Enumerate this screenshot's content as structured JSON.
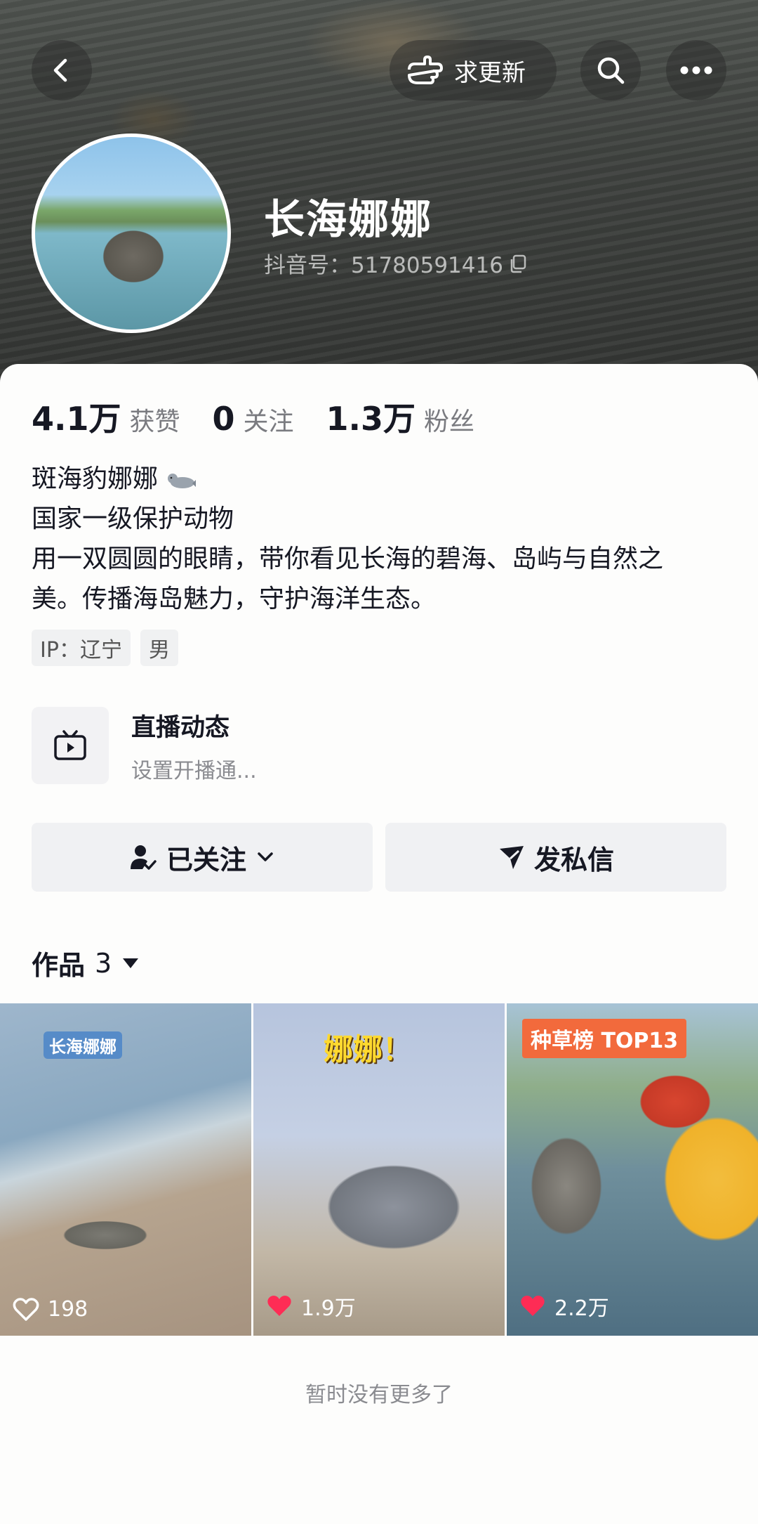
{
  "header": {
    "update_label": "求更新"
  },
  "profile": {
    "nickname": "长海娜娜",
    "douyin_id": "抖音号：51780591416"
  },
  "stats": [
    {
      "value": "4.1万",
      "label": "获赞"
    },
    {
      "value": "0",
      "label": "关注"
    },
    {
      "value": "1.3万",
      "label": "粉丝"
    }
  ],
  "bio": {
    "line1": "斑海豹娜娜",
    "line2": "国家一级保护动物",
    "line3": "用一双圆圆的眼睛，带你看见长海的碧海、岛屿与自然之",
    "line4": "美。传播海岛魅力，守护海洋生态。"
  },
  "tags": [
    "IP：辽宁",
    "男"
  ],
  "live": {
    "title": "直播动态",
    "subtitle": "设置开播通..."
  },
  "actions": {
    "follow_label": "已关注",
    "message_label": "发私信"
  },
  "works": {
    "label": "作品",
    "count": "3",
    "items": [
      {
        "overlay": "长海娜娜",
        "likes": "198",
        "liked": false
      },
      {
        "overlay": "娜娜！",
        "likes": "1.9万",
        "liked": true
      },
      {
        "overlay": "种草榜 TOP13",
        "likes": "2.2万",
        "liked": true
      }
    ]
  },
  "footer": {
    "no_more": "暂时没有更多了"
  },
  "colors": {
    "accent_red": "#fe2c55",
    "badge_orange": "#f26a3c"
  }
}
